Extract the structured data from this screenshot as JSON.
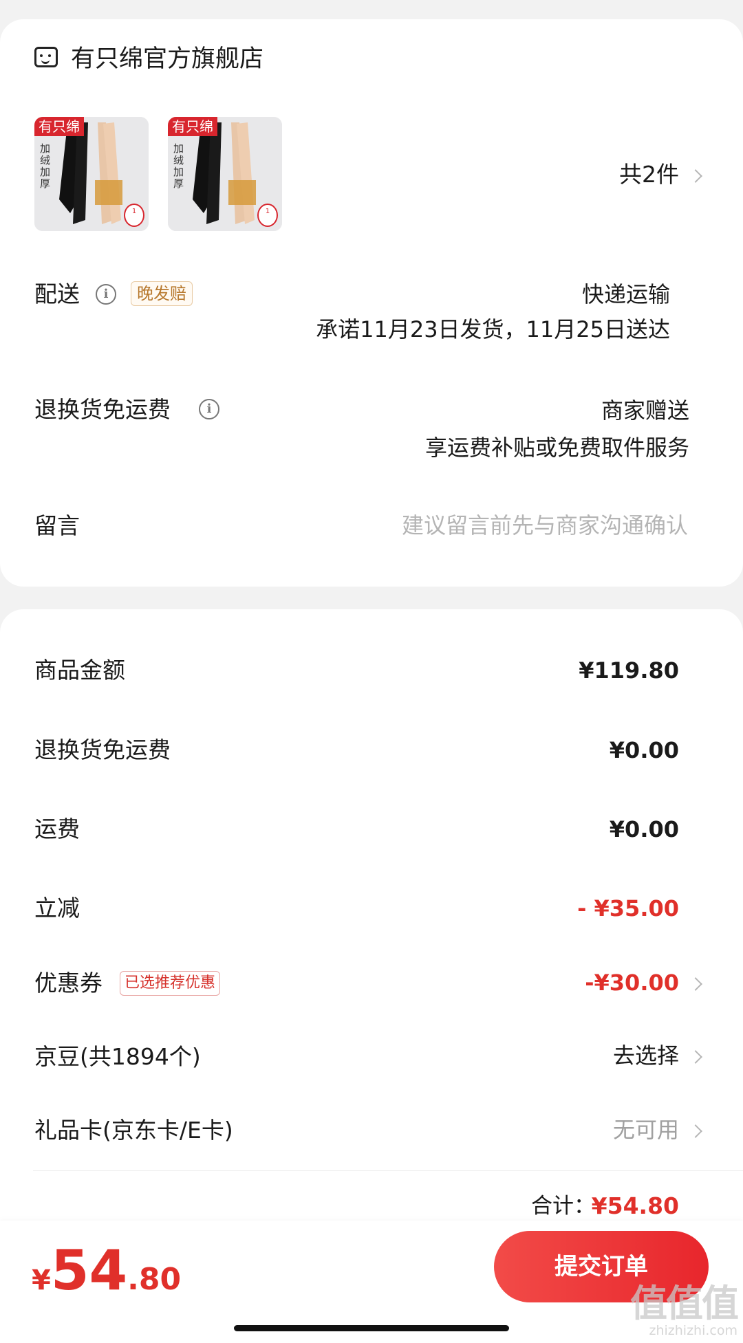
{
  "store": {
    "name": "有只绵官方旗舰店",
    "icon": "store-icon"
  },
  "products": {
    "images": [
      {
        "tag": "有只绵",
        "text": "加绒加厚",
        "badge": "1"
      },
      {
        "tag": "有只绵",
        "text": "加绒加厚",
        "badge": "1"
      }
    ],
    "count_label": "共2件"
  },
  "delivery": {
    "label": "配送",
    "badge": "晚发赔",
    "method": "快递运输",
    "promise": "承诺11月23日发货，11月25日送达"
  },
  "return_shipping": {
    "label": "退换货免运费",
    "value": "商家赠送",
    "desc": "享运费补贴或免费取件服务"
  },
  "message": {
    "label": "留言",
    "placeholder": "建议留言前先与商家沟通确认"
  },
  "summary": {
    "goods_label": "商品金额",
    "goods_value": "¥119.80",
    "return_fee_label": "退换货免运费",
    "return_fee_value": "¥0.00",
    "shipping_label": "运费",
    "shipping_value": "¥0.00",
    "discount_label": "立减",
    "discount_value": "- ¥35.00",
    "coupon_label": "优惠券",
    "coupon_badge": "已选推荐优惠",
    "coupon_value": "-¥30.00",
    "jingdou_label": "京豆(共1894个)",
    "jingdou_value": "去选择",
    "giftcard_label": "礼品卡(京东卡/E卡)",
    "giftcard_value": "无可用",
    "total_label": "合计：",
    "total_value": "¥54.80"
  },
  "bottom": {
    "currency": "¥",
    "amount_int": "54",
    "amount_dec": ".80",
    "submit_label": "提交订单"
  },
  "watermark": {
    "big": "值值值",
    "small": "zhizhizhi.com"
  },
  "colors": {
    "accent": "#e0302a",
    "late_badge": "#b7782d",
    "background": "#f2f2f2"
  }
}
